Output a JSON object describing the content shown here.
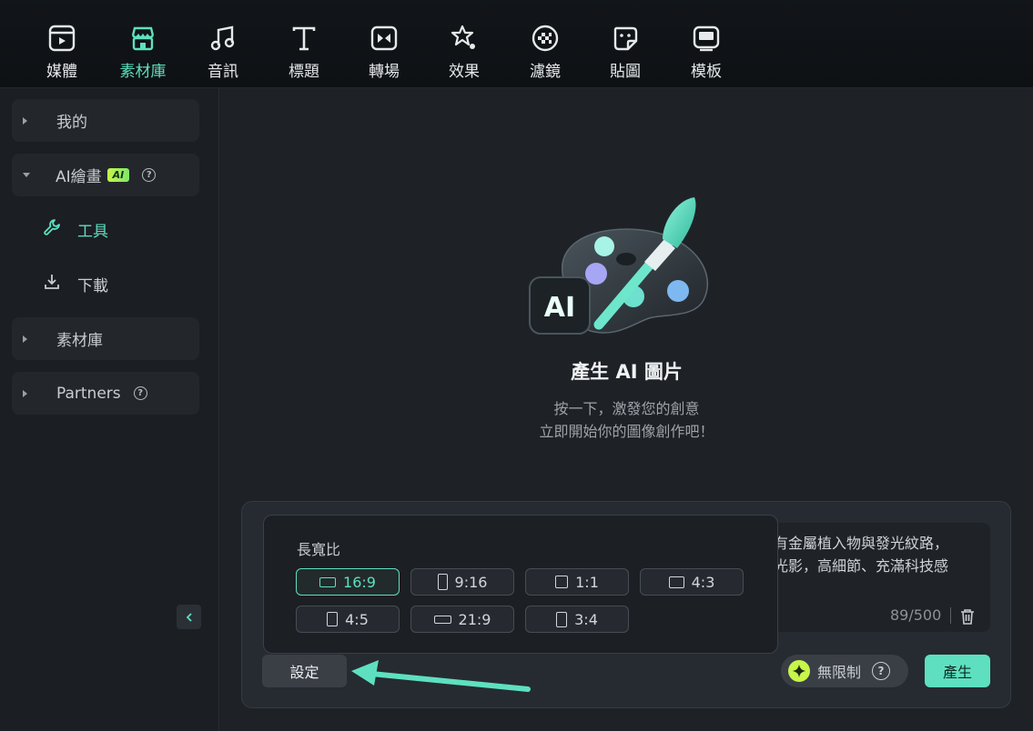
{
  "toolbar": {
    "tabs": [
      {
        "label": "媒體",
        "icon": "media-icon"
      },
      {
        "label": "素材庫",
        "icon": "stock-icon"
      },
      {
        "label": "音訊",
        "icon": "audio-icon"
      },
      {
        "label": "標題",
        "icon": "title-icon"
      },
      {
        "label": "轉場",
        "icon": "transition-icon"
      },
      {
        "label": "效果",
        "icon": "effects-icon"
      },
      {
        "label": "濾鏡",
        "icon": "filter-icon"
      },
      {
        "label": "貼圖",
        "icon": "sticker-icon"
      },
      {
        "label": "模板",
        "icon": "template-icon"
      }
    ],
    "active_index": 1
  },
  "sidebar": {
    "groups": [
      {
        "label": "我的"
      },
      {
        "label": "AI繪畫",
        "badge": "AI"
      },
      {
        "label": "素材庫"
      },
      {
        "label": "Partners"
      }
    ],
    "items": [
      {
        "label": "工具",
        "icon": "wrench-icon"
      },
      {
        "label": "下載",
        "icon": "download-icon"
      }
    ],
    "help_glyph": "?"
  },
  "hero": {
    "icon_text": "AI",
    "title": "產生 AI 圖片",
    "line1": "按一下，激發您的創意",
    "line2": "立即開始你的圖像創作吧！"
  },
  "prompt": {
    "text": "有金屬植入物與發光紋路，\n光影，高細節、充滿科技感",
    "counter": "89/500"
  },
  "aspect_ratio": {
    "title": "長寬比",
    "options": [
      "16:9",
      "9:16",
      "1:1",
      "4:3",
      "4:5",
      "21:9",
      "3:4"
    ],
    "selected": "16:9"
  },
  "footer": {
    "settings_label": "設定",
    "unlimited_label": "無限制",
    "help_glyph": "?",
    "generate_label": "產生"
  },
  "colors": {
    "accent": "#5ee0c0",
    "badge": "#c8f54a",
    "background": "#1e2227"
  }
}
